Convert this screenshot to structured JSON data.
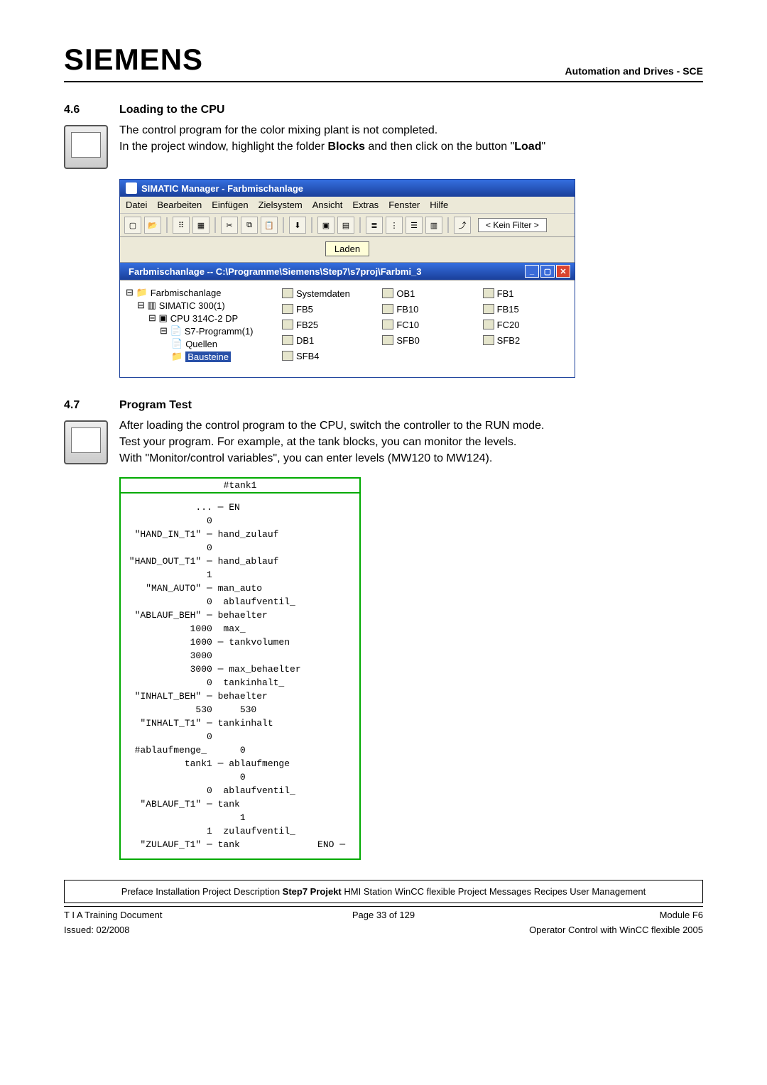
{
  "header": {
    "logo": "SIEMENS",
    "right": "Automation and Drives - SCE"
  },
  "section46": {
    "num": "4.6",
    "title": "Loading to the CPU",
    "p1": "The control program for the color mixing plant is not completed.",
    "p2a": "In the project window, highlight the folder ",
    "p2b": "Blocks",
    "p2c": " and then click on the button \"",
    "p2d": "Load",
    "p2e": "\""
  },
  "simatic": {
    "title": "SIMATIC Manager - Farbmischanlage",
    "menu": [
      "Datei",
      "Bearbeiten",
      "Einfügen",
      "Zielsystem",
      "Ansicht",
      "Extras",
      "Fenster",
      "Hilfe"
    ],
    "filter": "< Kein Filter >",
    "laden": "Laden",
    "inner_title": "Farbmischanlage -- C:\\Programme\\Siemens\\Step7\\s7proj\\Farbmi_3",
    "tree": {
      "root": "Farbmischanlage",
      "n1": "SIMATIC 300(1)",
      "n2": "CPU 314C-2 DP",
      "n3": "S7-Programm(1)",
      "n4": "Quellen",
      "n5": "Bausteine"
    },
    "blocks": {
      "c1": [
        "Systemdaten",
        "FB5",
        "FB25",
        "DB1",
        "SFB4"
      ],
      "c2": [
        "OB1",
        "FB10",
        "FC10",
        "SFB0"
      ],
      "c3": [
        "FB1",
        "FB15",
        "FC20",
        "SFB2"
      ]
    }
  },
  "section47": {
    "num": "4.7",
    "title": "Program Test",
    "p1": "After loading the control program to the CPU, switch the controller to the RUN mode.",
    "p2": "Test your program.  For example, at the tank blocks, you can monitor the levels.",
    "p3": "With \"Monitor/control variables\", you can enter levels (MW120 to MW124)."
  },
  "fbd": {
    "block_name": "#tank1",
    "lines": [
      "             ... ─ EN",
      "               0",
      "  \"HAND_IN_T1\" ─ hand_zulauf",
      "               0",
      " \"HAND_OUT_T1\" ─ hand_ablauf",
      "               1",
      "    \"MAN_AUTO\" ─ man_auto",
      "",
      "               0  ablaufventil_",
      "  \"ABLAUF_BEH\" ─ behaelter",
      "",
      "            1000  max_",
      "            1000 ─ tankvolumen",
      "            3000",
      "            3000 ─ max_behaelter",
      "",
      "               0  tankinhalt_",
      "  \"INHALT_BEH\" ─ behaelter",
      "             530     530",
      "   \"INHALT_T1\" ─ tankinhalt",
      "               0",
      "  #ablaufmenge_      0",
      "           tank1 ─ ablaufmenge",
      "                     0",
      "               0  ablaufventil_",
      "   \"ABLAUF_T1\" ─ tank",
      "                     1",
      "               1  zulaufventil_",
      "   \"ZULAUF_T1\" ─ tank              ENO ─"
    ]
  },
  "breadcrumb": {
    "pre": "Preface Installation Project Description ",
    "bold": "Step7 Projekt",
    "post": " HMI Station WinCC flexible Project Messages Recipes User Management"
  },
  "footer": {
    "left1": "T I A  Training Document",
    "center1": "Page 33 of 129",
    "right1": "Module F6",
    "left2": "Issued: 02/2008",
    "right2": "Operator Control with WinCC flexible 2005"
  }
}
